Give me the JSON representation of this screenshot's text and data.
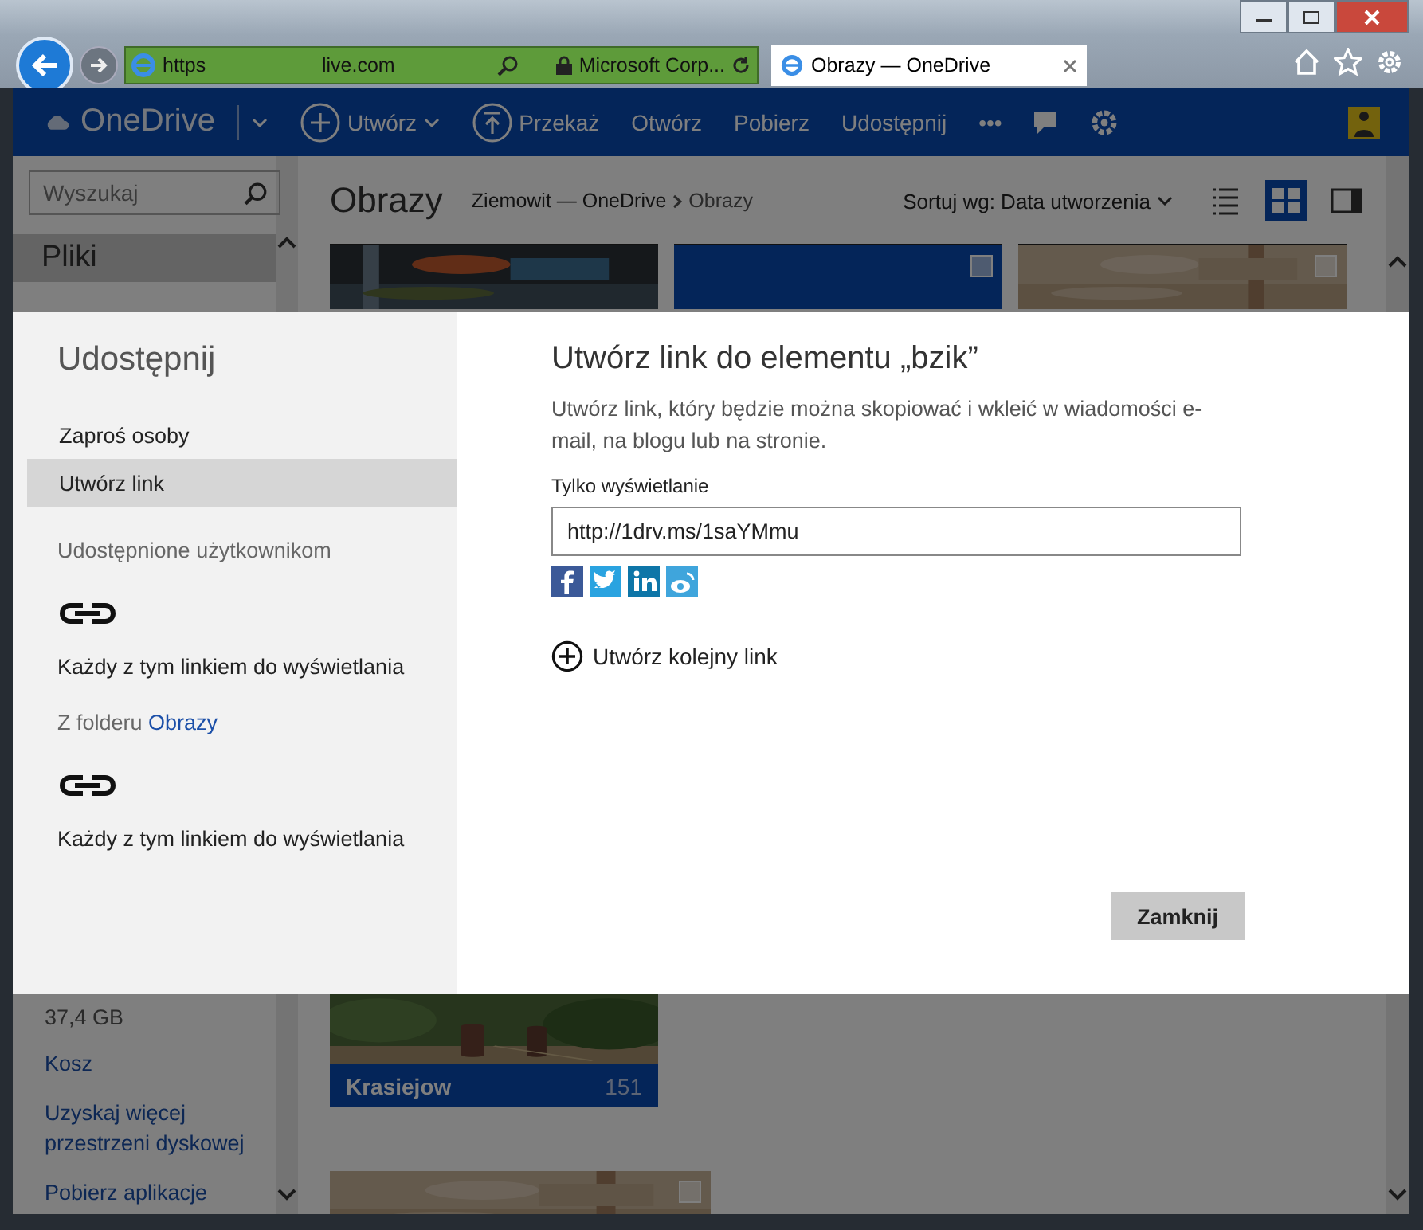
{
  "browser": {
    "address": {
      "scheme": "https",
      "domain": "live.com",
      "certificate": "Microsoft Corp..."
    },
    "tabs": [
      {
        "title": "Obrazy — OneDrive",
        "selected": true
      }
    ]
  },
  "header": {
    "brand": "OneDrive",
    "commands": [
      {
        "kind": "create",
        "label": "Utwórz"
      },
      {
        "kind": "upload",
        "label": "Przekaż"
      },
      {
        "kind": "plain",
        "label": "Otwórz"
      },
      {
        "kind": "plain",
        "label": "Pobierz"
      },
      {
        "kind": "plain",
        "label": "Udostępnij"
      }
    ],
    "more": "•••"
  },
  "sidebar": {
    "search": {
      "placeholder": "Wyszukaj"
    },
    "items": [
      {
        "label": "Pliki",
        "selected": true
      }
    ],
    "storage": "37,4 GB",
    "links": [
      "Kosz",
      "Uzyskaj więcej przestrzeni dyskowej",
      "Pobierz aplikacje"
    ]
  },
  "main": {
    "title": "Obrazy",
    "breadcrumb": [
      "Ziemowit — OneDrive",
      "Obrazy"
    ],
    "sort": "Sortuj wg: Data utworzenia",
    "views": [
      {
        "kind": "list",
        "selected": false
      },
      {
        "kind": "grid",
        "selected": true
      },
      {
        "kind": "pane",
        "selected": false
      }
    ],
    "tiles": [
      {
        "kind": "picture"
      },
      {
        "kind": "blank",
        "checked": false
      },
      {
        "kind": "picture",
        "checked": false
      }
    ],
    "album": {
      "name": "Krasiejow",
      "count": "151"
    },
    "bottom_tile": {
      "checked": false
    }
  },
  "dialog": {
    "title": "Udostępnij",
    "menu": [
      {
        "label": "Zaproś osoby",
        "selected": false
      },
      {
        "label": "Utwórz link",
        "selected": true
      }
    ],
    "sections": [
      {
        "heading": "Udostępnione użytkownikom",
        "entry": "Każdy z tym linkiem do wyświetlania"
      },
      {
        "heading": "Z folderu ",
        "link": "Obrazy",
        "entry": "Każdy z tym linkiem do wyświetlania"
      }
    ],
    "heading": "Utwórz link do elementu „bzik”",
    "description": "Utwórz link, który będzie można skopiować i wkleić w wiadomości e-mail, na blogu lub na stronie.",
    "field_label": "Tylko wyświetlanie",
    "link_value": "http://1drv.ms/1saYMmu",
    "share_targets": [
      {
        "kind": "facebook"
      },
      {
        "kind": "twitter"
      },
      {
        "kind": "linkedin"
      },
      {
        "kind": "weibo"
      }
    ],
    "another_link": "Utwórz kolejny link",
    "close": "Zamknij"
  }
}
